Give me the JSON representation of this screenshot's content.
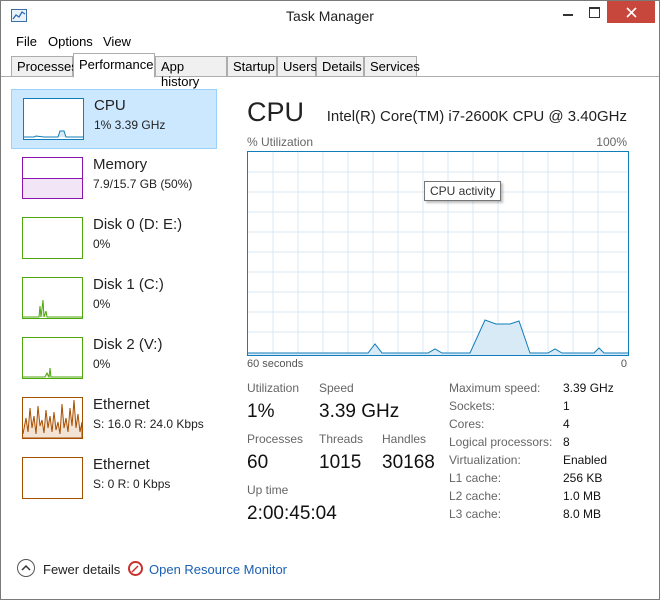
{
  "window": {
    "title": "Task Manager"
  },
  "menu": [
    "File",
    "Options",
    "View"
  ],
  "tabs": [
    "Processes",
    "Performance",
    "App history",
    "Startup",
    "Users",
    "Details",
    "Services"
  ],
  "sidebar": {
    "items": [
      {
        "title": "CPU",
        "sub": "1% 3.39 GHz",
        "color": "#117dbb"
      },
      {
        "title": "Memory",
        "sub": "7.9/15.7 GB (50%)",
        "color": "#8b12ae"
      },
      {
        "title": "Disk 0 (D: E:)",
        "sub": "0%",
        "color": "#4da60c"
      },
      {
        "title": "Disk 1 (C:)",
        "sub": "0%",
        "color": "#4da60c"
      },
      {
        "title": "Disk 2 (V:)",
        "sub": "0%",
        "color": "#4da60c"
      },
      {
        "title": "Ethernet",
        "sub": "S: 16.0  R: 24.0 Kbps",
        "color": "#a74f01"
      },
      {
        "title": "Ethernet",
        "sub": "S: 0  R: 0 Kbps",
        "color": "#a74f01"
      }
    ]
  },
  "main": {
    "title": "CPU",
    "subtitle": "Intel(R) Core(TM) i7-2600K CPU @ 3.40GHz",
    "graph_label_left": "% Utilization",
    "graph_label_right": "100%",
    "tooltip": "CPU activity",
    "axis_left": "60 seconds",
    "axis_right": "0",
    "accent": "#117dbb"
  },
  "stats": {
    "utilization": {
      "label": "Utilization",
      "value": "1%"
    },
    "speed": {
      "label": "Speed",
      "value": "3.39 GHz"
    },
    "processes": {
      "label": "Processes",
      "value": "60"
    },
    "threads": {
      "label": "Threads",
      "value": "1015"
    },
    "handles": {
      "label": "Handles",
      "value": "30168"
    },
    "uptime": {
      "label": "Up time",
      "value": "2:00:45:04"
    }
  },
  "specs": [
    {
      "label": "Maximum speed:",
      "value": "3.39 GHz"
    },
    {
      "label": "Sockets:",
      "value": "1"
    },
    {
      "label": "Cores:",
      "value": "4"
    },
    {
      "label": "Logical processors:",
      "value": "8"
    },
    {
      "label": "Virtualization:",
      "value": "Enabled"
    },
    {
      "label": "L1 cache:",
      "value": "256 KB"
    },
    {
      "label": "L2 cache:",
      "value": "1.0 MB"
    },
    {
      "label": "L3 cache:",
      "value": "8.0 MB"
    }
  ],
  "footer": {
    "fewer_details": "Fewer details",
    "open_resmon": "Open Resource Monitor"
  }
}
